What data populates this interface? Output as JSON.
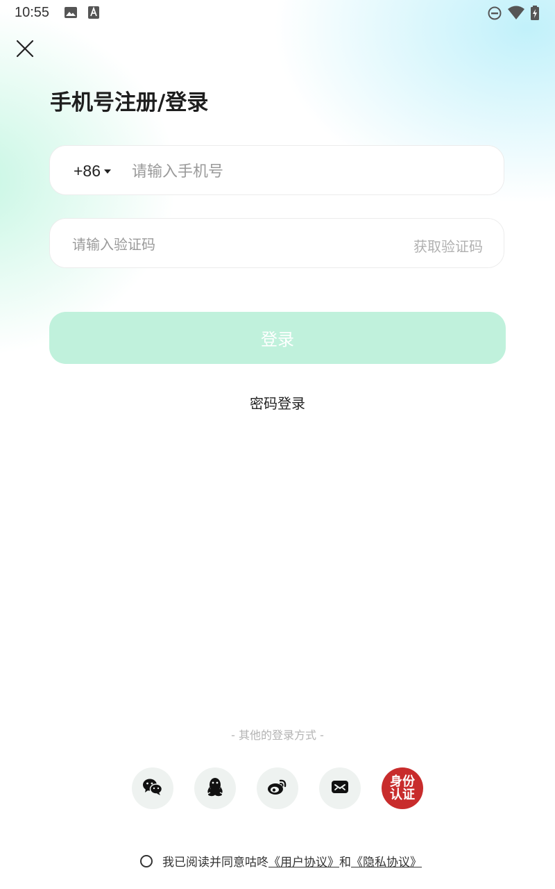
{
  "status_bar": {
    "time": "10:55",
    "icons": [
      "image-icon",
      "text-a-icon",
      "dnd-icon",
      "wifi-icon",
      "battery-charging-icon"
    ]
  },
  "close_icon": "close-icon",
  "title": "手机号注册/登录",
  "phone": {
    "country_code": "+86",
    "placeholder": "请输入手机号",
    "value": ""
  },
  "code": {
    "placeholder": "请输入验证码",
    "value": "",
    "get_code_label": "获取验证码"
  },
  "login_button": "登录",
  "password_login": "密码登录",
  "other_methods": "- 其他的登录方式 -",
  "social_logins": [
    {
      "icon": "wechat-icon"
    },
    {
      "icon": "qq-icon"
    },
    {
      "icon": "weibo-icon"
    },
    {
      "icon": "mail-icon"
    },
    {
      "icon": "id-verify-icon",
      "label_top": "身份",
      "label_bottom": "认证"
    }
  ],
  "agreement": {
    "prefix": "我已阅读并同意咕咚",
    "user_agreement": "《用户协议》",
    "conjunction": "和",
    "privacy_agreement": "《隐私协议》"
  },
  "colors": {
    "login_button_bg": "#c0f1dc",
    "id_badge": "#c82c2c",
    "social_bg": "#eef2f0"
  }
}
